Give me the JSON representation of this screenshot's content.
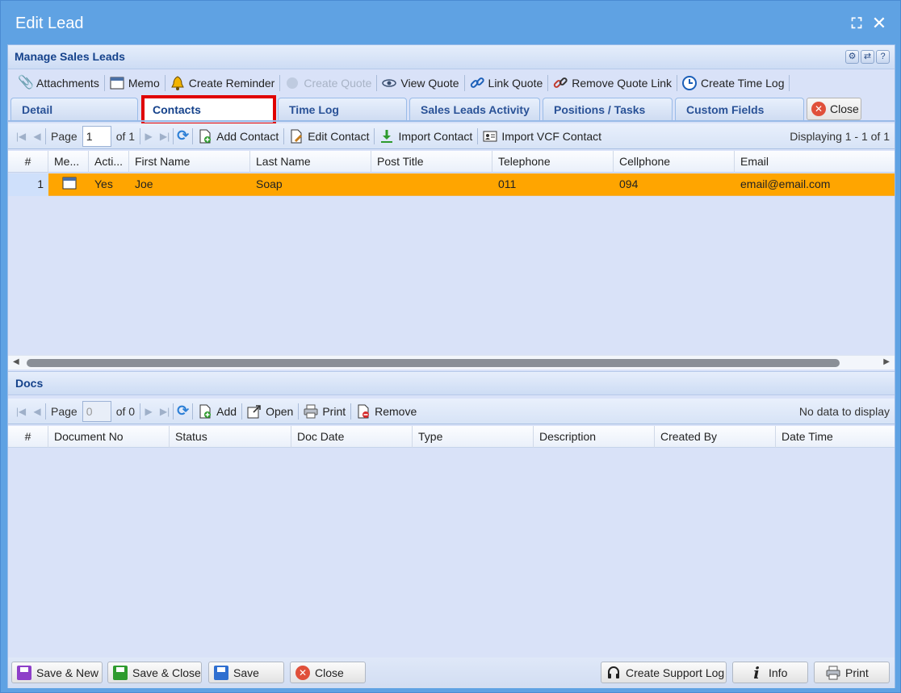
{
  "window": {
    "title": "Edit Lead"
  },
  "panel": {
    "title": "Manage Sales Leads"
  },
  "toolbar": [
    {
      "label": "Attachments",
      "icon": "paperclip-icon",
      "disabled": false
    },
    {
      "label": "Memo",
      "icon": "memo-icon",
      "disabled": false
    },
    {
      "label": "Create Reminder",
      "icon": "bell-icon",
      "disabled": false
    },
    {
      "label": "Create Quote",
      "icon": "quote-icon",
      "disabled": true
    },
    {
      "label": "View Quote",
      "icon": "eye-icon",
      "disabled": false
    },
    {
      "label": "Link Quote",
      "icon": "link-icon",
      "disabled": false
    },
    {
      "label": "Remove Quote Link",
      "icon": "unlink-icon",
      "disabled": false
    },
    {
      "label": "Create Time Log",
      "icon": "clock-icon",
      "disabled": false
    }
  ],
  "tabs": [
    {
      "label": "Detail"
    },
    {
      "label": "Contacts"
    },
    {
      "label": "Time Log"
    },
    {
      "label": "Sales Leads Activity"
    },
    {
      "label": "Positions / Tasks"
    },
    {
      "label": "Custom Fields"
    }
  ],
  "tab_close_label": "Close",
  "contacts": {
    "paging": {
      "page_label": "Page",
      "page_value": "1",
      "of_label": "of 1",
      "display": "Displaying 1 - 1 of 1"
    },
    "actions": {
      "add": "Add Contact",
      "edit": "Edit Contact",
      "import": "Import Contact",
      "import_vcf": "Import VCF Contact"
    },
    "columns": [
      "#",
      "Me...",
      "Acti...",
      "First Name",
      "Last Name",
      "Post Title",
      "Telephone",
      "Cellphone",
      "Email"
    ],
    "rows": [
      {
        "num": "1",
        "active": "Yes",
        "first": "Joe",
        "last": "Soap",
        "post": "",
        "tel": "011",
        "cell": "094",
        "email": "email@email.com"
      }
    ]
  },
  "docs": {
    "title": "Docs",
    "paging": {
      "page_label": "Page",
      "page_value": "0",
      "of_label": "of 0",
      "display": "No data to display"
    },
    "actions": {
      "add": "Add",
      "open": "Open",
      "print": "Print",
      "remove": "Remove"
    },
    "columns": [
      "#",
      "Document No",
      "Status",
      "Doc Date",
      "Type",
      "Description",
      "Created By",
      "Date Time"
    ]
  },
  "buttons": {
    "save_new": "Save & New",
    "save_close": "Save & Close",
    "save": "Save",
    "close": "Close",
    "support_log": "Create Support Log",
    "info": "Info",
    "print": "Print"
  },
  "colors": {
    "row_highlight": "#ffa500",
    "tab_highlight_border": "#e00000",
    "window_bg": "#5fa2e3"
  }
}
